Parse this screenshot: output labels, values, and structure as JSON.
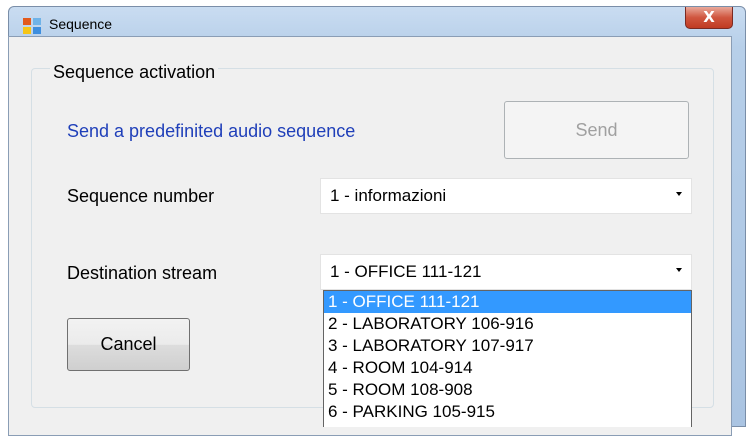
{
  "window": {
    "title": "Sequence",
    "close_label": "X",
    "icon": "windows-form-icon"
  },
  "group": {
    "title": "Sequence activation"
  },
  "send_prompt": "Send a predefinited audio sequence",
  "send_button": {
    "label": "Send",
    "enabled": false
  },
  "sequence": {
    "label": "Sequence number",
    "value": "1 - informazioni"
  },
  "destination": {
    "label": "Destination stream",
    "value": "1 - OFFICE 111-121",
    "options": [
      "1 - OFFICE 111-121",
      "2 - LABORATORY 106-916",
      "3 - LABORATORY 107-917",
      "4 - ROOM 104-914",
      "5 - ROOM 108-908",
      "6 - PARKING 105-915"
    ],
    "selected_index": 0
  },
  "cancel_button": {
    "label": "Cancel"
  },
  "colors": {
    "link_text": "#1f3fb9",
    "selection": "#3399ff",
    "close_button": "#c03a22"
  }
}
